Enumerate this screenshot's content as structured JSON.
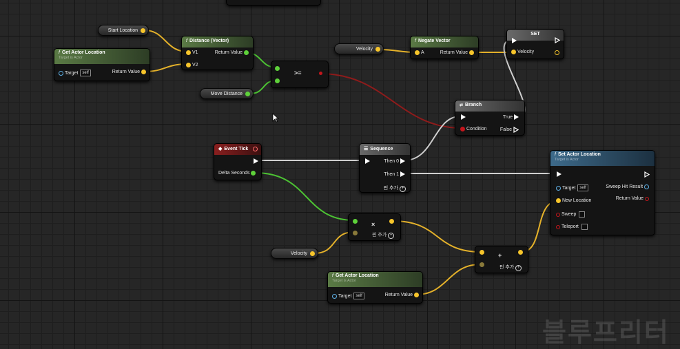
{
  "graph": {
    "start_location": "Start Location",
    "get_actor_location_1": {
      "title": "Get Actor Location",
      "subtitle": "Target is Actor",
      "target": "Target",
      "self": "self",
      "return": "Return Value"
    },
    "distance": {
      "title": "Distance (Vector)",
      "v1": "V1",
      "v2": "V2",
      "return": "Return Value"
    },
    "compare": {
      "op": ">="
    },
    "move_distance": "Move Distance",
    "velocity_get_1": "Velocity",
    "negate": {
      "title": "Negate Vector",
      "a": "A",
      "return": "Return Value"
    },
    "set_node": {
      "title": "SET",
      "velocity": "Velocity"
    },
    "branch": {
      "title": "Branch",
      "true": "True",
      "false": "False",
      "condition": "Condition"
    },
    "event_tick": {
      "title": "Event Tick",
      "delta": "Delta Seconds"
    },
    "sequence": {
      "title": "Sequence",
      "then0": "Then 0",
      "then1": "Then 1",
      "add_pin": "핀 추가"
    },
    "set_actor_location": {
      "title": "Set Actor Location",
      "subtitle": "Target is Actor",
      "target": "Target",
      "self": "self",
      "sweep_hit": "Sweep Hit Result",
      "new_location": "New Location",
      "return": "Return Value",
      "sweep": "Sweep",
      "teleport": "Teleport"
    },
    "multiply": {
      "op": "×",
      "add_pin": "핀 추가"
    },
    "velocity_get_2": "Velocity",
    "add": {
      "op": "+",
      "add_pin": "핀 추가"
    },
    "get_actor_location_2": {
      "title": "Get Actor Location",
      "subtitle": "Target is Actor",
      "target": "Target",
      "self": "self",
      "return": "Return Value"
    }
  },
  "watermark": "블루프리터"
}
